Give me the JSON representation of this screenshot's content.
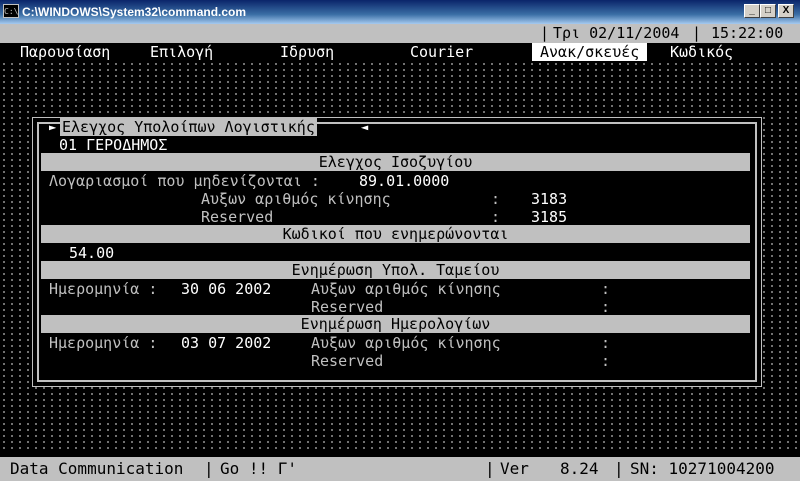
{
  "window": {
    "title": "C:\\WINDOWS\\System32\\command.com",
    "icon_label": "C:\\",
    "buttons": {
      "minimize": "_",
      "maximize": "□",
      "close": "X"
    }
  },
  "header": {
    "date": "Τρι 02/11/2004",
    "time": "15:22:00"
  },
  "menu": {
    "items": [
      {
        "label": "Παρουσίαση",
        "selected": false
      },
      {
        "label": "Επιλογή",
        "selected": false
      },
      {
        "label": "Ιδρυση",
        "selected": false
      },
      {
        "label": "Courier",
        "selected": false
      },
      {
        "label": "Ανακ/σκευές",
        "selected": true
      },
      {
        "label": "Κωδικός",
        "selected": false
      }
    ]
  },
  "dialog": {
    "title": "Ελεγχος Υπολοίπων Λογιστικής",
    "arrow_right": "►",
    "arrow_left": "◄",
    "company": "01 ΓΕΡΟΔΗΜΟΣ",
    "section1": {
      "heading": "Ελεγχος Ισοζυγίου",
      "accounts_label": "Λογαριασμοί που μηδενίζονται :",
      "accounts_value": "89.01.0000",
      "seq_label": "Αυξων αριθμός κίνησης",
      "seq_colon": ":",
      "seq_value": "3183",
      "reserved_label": "Reserved",
      "reserved_colon": ":",
      "reserved_value": "3185"
    },
    "section2": {
      "heading": "Κωδικοί που ενημερώνονται",
      "value": "54.00"
    },
    "section3": {
      "heading": "Ενημέρωση Υπολ. Ταμείου",
      "date_label": "Ημερομηνία :",
      "date_value": "30 06 2002",
      "seq_label": "Αυξων αριθμός κίνησης",
      "seq_colon": ":",
      "reserved_label": "Reserved",
      "reserved_colon": ":"
    },
    "section4": {
      "heading": "Ενημέρωση Ημερολογίων",
      "date_label": "Ημερομηνία :",
      "date_value": "03 07 2002",
      "seq_label": "Αυξων αριθμός κίνησης",
      "seq_colon": ":",
      "reserved_label": "Reserved",
      "reserved_colon": ":"
    }
  },
  "status": {
    "left": "Data Communication",
    "sep1": "|",
    "go": "Go !! Γ'",
    "sep2": "|",
    "version_label": "Ver",
    "version_value": "8.24",
    "sep3": "|",
    "serial": "SN: 10271004200"
  },
  "colors": {
    "background": "#000000",
    "foreground": "#ffffff",
    "panel_grey": "#c0c0c0",
    "titlebar": "#0a246a"
  }
}
